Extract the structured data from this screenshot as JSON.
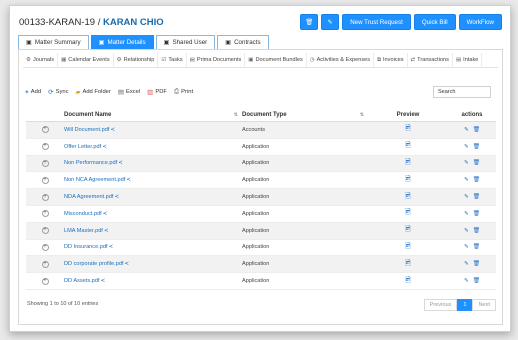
{
  "header": {
    "matter_code": "00133-KARAN-19",
    "separator": "/",
    "client_name": "KARAN CHIO",
    "buttons": {
      "delete_icon": "trash-icon",
      "edit_icon": "pencil-icon",
      "new_trust_request": "New Trust Request",
      "quick_bill": "Quick Bill",
      "workflow": "WorkFlow"
    }
  },
  "primary_tabs": [
    {
      "label": "Matter Summary",
      "icon": "folder-icon"
    },
    {
      "label": "Matter Details",
      "icon": "folder-icon",
      "active": true
    },
    {
      "label": "Shared User",
      "icon": "folder-icon"
    },
    {
      "label": "Contracts",
      "icon": "folder-icon"
    }
  ],
  "secondary_tabs": [
    {
      "label": "Journals",
      "icon": "gear-icon"
    },
    {
      "label": "Calendar Events",
      "icon": "calendar-icon"
    },
    {
      "label": "Relationship",
      "icon": "gear-icon"
    },
    {
      "label": "Tasks",
      "icon": "check-icon"
    },
    {
      "label": "Prima Documents",
      "icon": "file-icon"
    },
    {
      "label": "Document Bundles",
      "icon": "folder-icon"
    },
    {
      "label": "Activities & Expenses",
      "icon": "clock-icon"
    },
    {
      "label": "Invoices",
      "icon": "copy-icon"
    },
    {
      "label": "Transactions",
      "icon": "exchange-icon"
    },
    {
      "label": "Intake",
      "icon": "file-icon"
    }
  ],
  "toolbar": {
    "add": "Add",
    "sync": "Sync",
    "add_folder": "Add Folder",
    "excel": "Excel",
    "pdf": "PDF",
    "print": "Print",
    "search_placeholder": "Search"
  },
  "table": {
    "columns": {
      "name": "Document Name",
      "type": "Document Type",
      "preview": "Preview",
      "actions": "actions"
    },
    "rows": [
      {
        "name": "Will Document.pdf",
        "type": "Accounts"
      },
      {
        "name": "Offer Letter.pdf",
        "type": "Application"
      },
      {
        "name": "Non Performance.pdf",
        "type": "Application"
      },
      {
        "name": "Non NCA Agreement.pdf",
        "type": "Application"
      },
      {
        "name": "NDA Agreement.pdf",
        "type": "Application"
      },
      {
        "name": "Misconduct.pdf",
        "type": "Application"
      },
      {
        "name": "LMA Master.pdf",
        "type": "Application"
      },
      {
        "name": "DD Insurance.pdf",
        "type": "Application"
      },
      {
        "name": "DD corporate profile.pdf",
        "type": "Application"
      },
      {
        "name": "DD Assets.pdf",
        "type": "Application"
      }
    ]
  },
  "footer": {
    "info": "Showing 1 to 10 of 10 entries",
    "previous": "Previous",
    "current_page": "1",
    "next": "Next"
  }
}
